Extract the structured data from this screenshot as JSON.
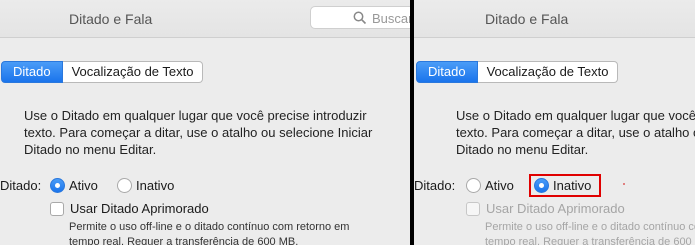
{
  "window": {
    "title": "Ditado e Fala"
  },
  "search": {
    "placeholder": "Buscar"
  },
  "tabs": [
    {
      "label": "Ditado",
      "active": true
    },
    {
      "label": "Vocalização de Texto",
      "active": false
    }
  ],
  "description": {
    "line1": "Use o Ditado em qualquer lugar que você precise introduzir",
    "line2": "texto. Para começar a ditar, use o atalho ou selecione Iniciar",
    "line3": "Ditado no menu Editar."
  },
  "dictation": {
    "label": "Ditado:",
    "option_on": "Ativo",
    "option_off": "Inativo"
  },
  "enhanced": {
    "label": "Usar Ditado Aprimorado",
    "note_line1": "Permite o uso off-line e o ditado contínuo com retorno em",
    "note_line2": "tempo real. Requer a transferência de 600 MB."
  },
  "left_panel": {
    "selected": "Ativo",
    "enhanced_enabled": true
  },
  "right_panel": {
    "selected": "Inativo",
    "enhanced_enabled": false,
    "highlighted_option": "Inativo"
  },
  "colors": {
    "accent": "#1a74ec",
    "highlight": "#e00000",
    "divider": "#000000"
  }
}
